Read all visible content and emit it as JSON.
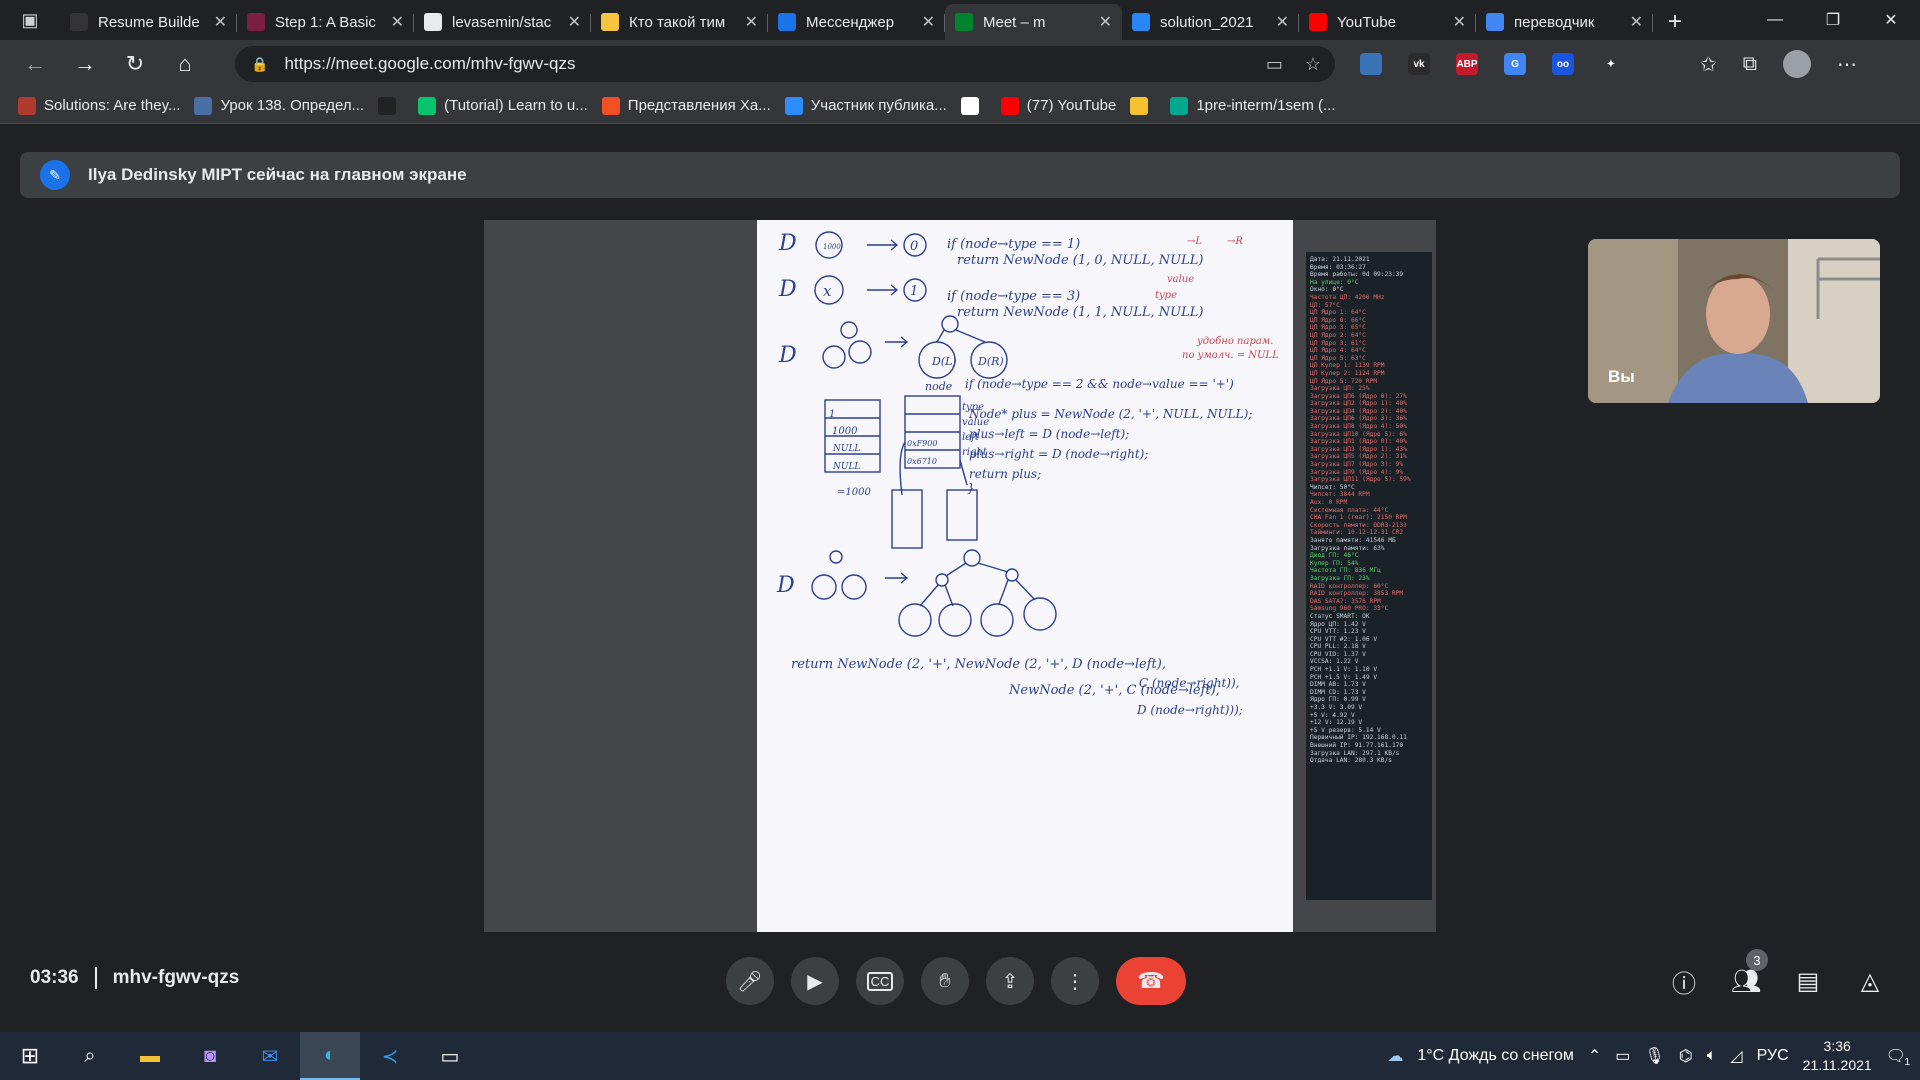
{
  "browser": {
    "tabs": [
      {
        "title": "Resume Builde",
        "favicon": "dark-bird-icon",
        "color": "#333333",
        "active": false
      },
      {
        "title": "Step 1: A Basic",
        "favicon": "arrow-logo-icon",
        "color": "#7a1f3d",
        "active": false
      },
      {
        "title": "levasemin/stac",
        "favicon": "github-icon",
        "color": "#e8eaed",
        "active": false
      },
      {
        "title": "Кто такой тим",
        "favicon": "yandex-zen-icon",
        "color": "#f5c542",
        "active": false
      },
      {
        "title": "Мессенджер",
        "favicon": "messenger-icon",
        "color": "#1a73e8",
        "active": false
      },
      {
        "title": "Meet – m",
        "favicon": "meet-icon",
        "color": "#00832d",
        "active": true
      },
      {
        "title": "solution_2021",
        "favicon": "vk-icon",
        "color": "#2787f5",
        "active": false
      },
      {
        "title": "YouTube",
        "favicon": "youtube-icon",
        "color": "#ff0000",
        "active": false
      },
      {
        "title": "переводчик",
        "favicon": "google-icon",
        "color": "#4285f4",
        "active": false
      }
    ],
    "url": "https://meet.google.com/mhv-fgwv-qzs",
    "bookmarks": [
      {
        "label": "Solutions: Are they...",
        "color": "#b03a2e"
      },
      {
        "label": "Урок 138. Определ...",
        "color": "#4a6fa5"
      },
      {
        "label": "",
        "color": "#222222"
      },
      {
        "label": "(Tutorial) Learn to u...",
        "color": "#05c46b"
      },
      {
        "label": "Представления Ха...",
        "color": "#f25022"
      },
      {
        "label": "Участник публика...",
        "color": "#2d8cff"
      },
      {
        "label": "",
        "color": "#ffffff"
      },
      {
        "label": "(77) YouTube",
        "color": "#ff0000"
      },
      {
        "label": "",
        "color": "#f7c22f"
      },
      {
        "label": "1pre-interm/1sem (...",
        "color": "#00a88f"
      }
    ],
    "extensions": [
      {
        "name": "drive-ext-icon",
        "text": "",
        "color": "#3b73b9"
      },
      {
        "name": "vk-ext-icon",
        "text": "vk",
        "color": "#2b2b2b"
      },
      {
        "name": "adblock-ext-icon",
        "text": "ABP",
        "color": "#c5192d"
      },
      {
        "name": "translate-ext-icon",
        "text": "G",
        "color": "#4285f4"
      },
      {
        "name": "glasses-ext-icon",
        "text": "oo",
        "color": "#1a56db"
      },
      {
        "name": "puzzle-ext-icon",
        "text": "✦",
        "color": "#35363a"
      }
    ]
  },
  "meet": {
    "banner": "Ilya Dedinsky MIPT сейчас на главном экране",
    "self_label": "Вы",
    "time": "03:36",
    "meeting_code": "mhv-fgwv-qzs",
    "participants_count": "3",
    "end_call_color": "#ea4335"
  },
  "whiteboard": {
    "lines": [
      "if (node→type == 1)",
      "return NewNode (1, 0, NULL, NULL)",
      "if (node→type == 3)",
      "return NewNode (1, 1, NULL, NULL)",
      "if (node→type == 2 && node→value == '+')",
      "Node* plus = NewNode (2, '+', NULL, NULL);",
      "plus→left = D (node→left);",
      "plus→right = D (node→right);",
      "return plus;",
      "return NewNode (2, '+', NewNode (2, '+', D (node→left),",
      "C (node→right)),",
      "NewNode (2, '+', C (node→left),",
      "D (node→right)));"
    ],
    "notes": [
      "→L",
      "→R",
      "value",
      "type",
      "удобно парам.",
      "по умолч. = NULL",
      "node",
      "type",
      "value",
      "left",
      "right",
      "=1000",
      "1000",
      "NULL",
      "NULL",
      "0xF900",
      "0x6710"
    ]
  },
  "sysmon": {
    "rows": [
      {
        "t": "Дата: 21.11.2021",
        "c": "n"
      },
      {
        "t": "Время: 03:36:27",
        "c": "n"
      },
      {
        "t": "Время работы: 0d 09:23:39",
        "c": "n"
      },
      {
        "t": "На улице: 0°C",
        "c": "g"
      },
      {
        "t": "Окно: 0°C",
        "c": "n"
      },
      {
        "t": "Частота ЦП: 4200 MHz",
        "c": "r"
      },
      {
        "t": "ЦП: 57°C",
        "c": "r"
      },
      {
        "t": "ЦП Ядро 1: 64°C",
        "c": "r"
      },
      {
        "t": "ЦП Ядро 0: 66°C",
        "c": "r"
      },
      {
        "t": "ЦП Ядро 3: 65°C",
        "c": "r"
      },
      {
        "t": "ЦП Ядро 2: 64°C",
        "c": "r"
      },
      {
        "t": "ЦП Ядро 3: 61°C",
        "c": "r"
      },
      {
        "t": "ЦП Ядро 4: 64°C",
        "c": "r"
      },
      {
        "t": "ЦП Ядро 5: 63°C",
        "c": "r"
      },
      {
        "t": "ЦП Кулер 1: 1139 RPM",
        "c": "r"
      },
      {
        "t": "ЦП Кулер 2: 1124 RPM",
        "c": "r"
      },
      {
        "t": "ЦП Ядро 5: 720 RPM",
        "c": "r"
      },
      {
        "t": "Загрузка ЦП: 25%",
        "c": "r"
      },
      {
        "t": "Загрузка ЦП6 (Ядро 0): 27%",
        "c": "r"
      },
      {
        "t": "Загрузка ЦП2 (Ядро 1): 40%",
        "c": "r"
      },
      {
        "t": "Загрузка ЦП4 (Ядро 2): 40%",
        "c": "r"
      },
      {
        "t": "Загрузка ЦП6 (Ядро 3): 36%",
        "c": "r"
      },
      {
        "t": "Загрузка ЦП8 (Ядро 4): 50%",
        "c": "r"
      },
      {
        "t": "Загрузка ЦП10 (Ядро 5): 6%",
        "c": "r"
      },
      {
        "t": "Загрузка ЦП1 (Ядро 0): 40%",
        "c": "r"
      },
      {
        "t": "Загрузка ЦП3 (Ядро 1): 43%",
        "c": "r"
      },
      {
        "t": "Загрузка ЦП5 (Ядро 2): 31%",
        "c": "r"
      },
      {
        "t": "Загрузка ЦП7 (Ядро 3): 9%",
        "c": "r"
      },
      {
        "t": "Загрузка ЦП9 (Ядро 4): 9%",
        "c": "r"
      },
      {
        "t": "Загрузка ЦП11 (Ядро 5): 59%",
        "c": "r"
      },
      {
        "t": "Чипсет: 50°C",
        "c": "n"
      },
      {
        "t": "Чипсет: 3844 RPM",
        "c": "r"
      },
      {
        "t": "Аux: 0 RPM",
        "c": "r"
      },
      {
        "t": "Системная плата: 44°C",
        "c": "r"
      },
      {
        "t": "CHA Fan 1 (rear): 2150 RPM",
        "c": "r"
      },
      {
        "t": "Скорость памяти: DDR3-2133",
        "c": "r"
      },
      {
        "t": "Тайминги: 10-12-12-31 CR2",
        "c": "r"
      },
      {
        "t": "Занято памяти: 41546 МБ",
        "c": "n"
      },
      {
        "t": "Загрузка памяти: 63%",
        "c": "n"
      },
      {
        "t": "Диод ГП: 46°C",
        "c": "g"
      },
      {
        "t": "Кулер ГП: 54%",
        "c": "g"
      },
      {
        "t": "Частота ГП: 836 МГц",
        "c": "g"
      },
      {
        "t": "Загрузка ГП: 23%",
        "c": "g"
      },
      {
        "t": "RAID контроллер: 60°C",
        "c": "r"
      },
      {
        "t": "RAID контроллер: 3853 RPM",
        "c": "r"
      },
      {
        "t": "DAS SATA7: 3576 RPM",
        "c": "r"
      },
      {
        "t": "Samsung 960 PRO: 33°C",
        "c": "r"
      },
      {
        "t": "Статус SMART: OK",
        "c": "n"
      },
      {
        "t": "Ядро ЦП: 1.42 V",
        "c": "n"
      },
      {
        "t": "CPU VTT: 1.23 V",
        "c": "n"
      },
      {
        "t": "CPU VTT #2: 1.06 V",
        "c": "n"
      },
      {
        "t": "CPU PLL: 2.18 V",
        "c": "n"
      },
      {
        "t": "CPU VID: 1.37 V",
        "c": "n"
      },
      {
        "t": "VCCSA: 1.22 V",
        "c": "n"
      },
      {
        "t": "PCH +1.1 V: 1.10 V",
        "c": "n"
      },
      {
        "t": "PCH +1.5 V: 1.49 V",
        "c": "n"
      },
      {
        "t": "DIMM AB: 1.73 V",
        "c": "n"
      },
      {
        "t": "DIMM CD: 1.73 V",
        "c": "n"
      },
      {
        "t": "Ядро ГП: 0.99 V",
        "c": "n"
      },
      {
        "t": "+3.3 V: 3.09 V",
        "c": "n"
      },
      {
        "t": "+5 V: 4.92 V",
        "c": "n"
      },
      {
        "t": "+12 V: 12.19 V",
        "c": "n"
      },
      {
        "t": "+5 V резерв: 5.14 V",
        "c": "n"
      },
      {
        "t": "Первичный IP: 192.168.0.11",
        "c": "n"
      },
      {
        "t": "Внешний IP: 91.77.161.170",
        "c": "n"
      },
      {
        "t": "Загрузка LAN: 297.1 KB/s",
        "c": "n"
      },
      {
        "t": "Отдача LAN: 280.3 KB/s",
        "c": "n"
      }
    ]
  },
  "taskbar": {
    "weather": "1°C Дождь со снегом",
    "lang": "РУС",
    "time": "3:36",
    "date": "21.11.2021",
    "notifications": "1"
  }
}
